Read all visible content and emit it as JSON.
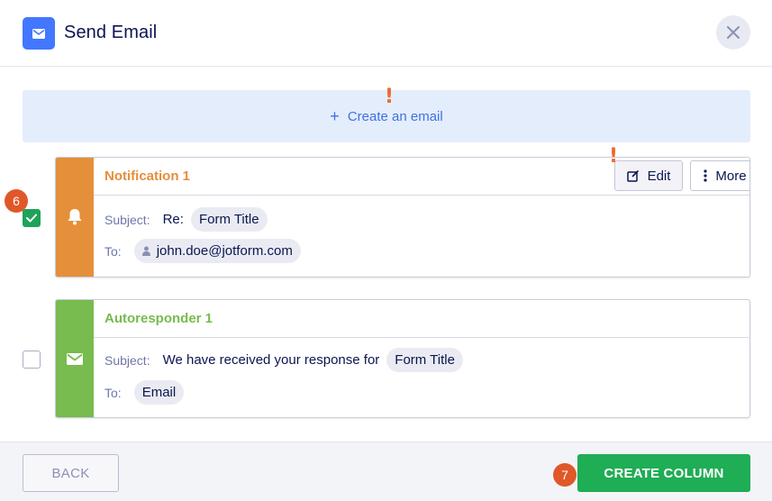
{
  "header": {
    "icon": "mail-icon",
    "title": "Send Email",
    "close_icon": "close-icon"
  },
  "create_email": {
    "icon": "plus-icon",
    "label": "Create an email"
  },
  "markers": {
    "warning": "!"
  },
  "emails": [
    {
      "title": "Notification 1",
      "accent": "#e58f3a",
      "icon": "bell-icon",
      "checked": true,
      "subject_label": "Subject:",
      "subject_prefix": "Re:",
      "subject_chip": "Form Title",
      "to_label": "To:",
      "to_chip": "john.doe@jotform.com",
      "edit_label": "Edit",
      "more_label": "More"
    },
    {
      "title": "Autoresponder 1",
      "accent": "#78bb4f",
      "icon": "mail-icon",
      "checked": false,
      "subject_label": "Subject:",
      "subject_prefix": "We have received your response for",
      "subject_chip": "Form Title",
      "to_label": "To:",
      "to_chip": "Email"
    }
  ],
  "steps": {
    "checkbox_step": "6",
    "create_step": "7"
  },
  "footer": {
    "back_label": "BACK",
    "create_label": "CREATE COLUMN"
  },
  "colors": {
    "primary_blue": "#4277ff",
    "create_green": "#1fad55",
    "badge_orange": "#e0582a"
  }
}
